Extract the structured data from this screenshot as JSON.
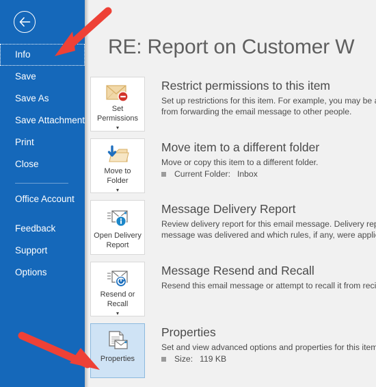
{
  "sidebar": {
    "back_button": {
      "name": "back-arrow",
      "label": "Back"
    },
    "items": [
      {
        "label": "Info",
        "selected": true
      },
      {
        "label": "Save",
        "selected": false
      },
      {
        "label": "Save As",
        "selected": false
      },
      {
        "label": "Save Attachments",
        "selected": false
      },
      {
        "label": "Print",
        "selected": false
      },
      {
        "label": "Close",
        "selected": false
      }
    ],
    "items_secondary": [
      {
        "label": "Office Account"
      },
      {
        "label": "Feedback"
      },
      {
        "label": "Support"
      },
      {
        "label": "Options"
      }
    ],
    "background_color": "#1568ba"
  },
  "header": {
    "title": "RE: Report on Customer W"
  },
  "sections": [
    {
      "button_label": "Set\nPermissions",
      "button_icon": "envelope-restricted-icon",
      "has_caret": true,
      "highlighted": false,
      "title": "Restrict permissions to this item",
      "description": "Set up restrictions for this item. For example, you may be able\nfrom forwarding the email message to other people.",
      "desc_line1": "Set up restrictions for this item. For example, you may be able",
      "desc_line2": "from forwarding the email message to other people.",
      "meta": null
    },
    {
      "button_label": "Move to\nFolder",
      "button_icon": "move-to-folder-icon",
      "has_caret": true,
      "highlighted": false,
      "title": "Move item to a different folder",
      "desc_line1": "Move or copy this item to a different folder.",
      "desc_line2": "",
      "meta": {
        "label": "Current Folder:",
        "value": "Inbox"
      }
    },
    {
      "button_label": "Open Delivery\nReport",
      "button_icon": "delivery-report-icon",
      "has_caret": false,
      "highlighted": false,
      "title": "Message Delivery Report",
      "desc_line1": "Review delivery report for this email message. Delivery report",
      "desc_line2": "message was delivered and which rules, if any, were applied t",
      "meta": null
    },
    {
      "button_label": "Resend or\nRecall",
      "button_icon": "resend-recall-icon",
      "has_caret": true,
      "highlighted": false,
      "title": "Message Resend and Recall",
      "desc_line1": "Resend this email message or attempt to recall it from recipie",
      "desc_line2": "",
      "meta": null
    },
    {
      "button_label": "Properties",
      "button_icon": "properties-document-icon",
      "has_caret": false,
      "highlighted": true,
      "title": "Properties",
      "desc_line1": "Set and view advanced options and properties for this item.",
      "desc_line2": "",
      "meta": {
        "label": "Size:",
        "value": "119 KB"
      }
    }
  ],
  "annotations": {
    "arrow_color": "#ee4136",
    "arrows": [
      {
        "name": "arrow-pointing-to-info",
        "target": "Info"
      },
      {
        "name": "arrow-pointing-to-properties",
        "target": "Properties"
      }
    ]
  }
}
